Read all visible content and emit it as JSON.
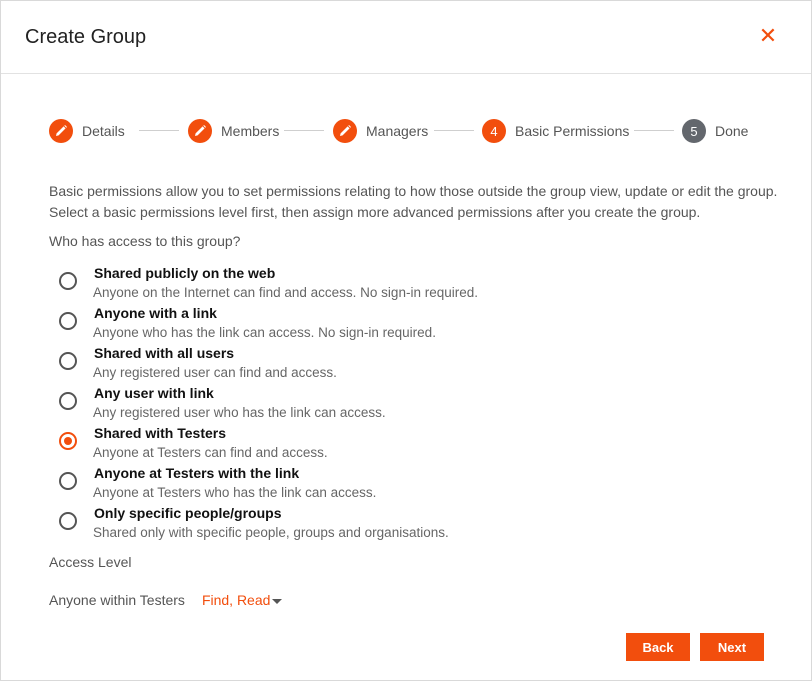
{
  "dialog": {
    "title": "Create Group",
    "close_symbol": "✕"
  },
  "stepper": {
    "steps": [
      {
        "label": "Details",
        "marker": "edit",
        "state": "complete"
      },
      {
        "label": "Members",
        "marker": "edit",
        "state": "complete"
      },
      {
        "label": "Managers",
        "marker": "edit",
        "state": "complete"
      },
      {
        "label": "Basic Permissions",
        "marker": "4",
        "state": "active"
      },
      {
        "label": "Done",
        "marker": "5",
        "state": "upcoming"
      }
    ]
  },
  "description": {
    "line1": "Basic permissions allow you to set permissions relating to how those outside the group view, update or edit the group.",
    "line2": "Select a basic permissions level first, then assign more advanced permissions after you create the group."
  },
  "question": "Who has access to this group?",
  "options": [
    {
      "title": "Shared publicly on the web",
      "subtitle": "Anyone on the Internet can find and access. No sign-in required.",
      "checked": false
    },
    {
      "title": "Anyone with a link",
      "subtitle": "Anyone who has the link can access. No sign-in required.",
      "checked": false
    },
    {
      "title": "Shared with all users",
      "subtitle": "Any registered user can find and access.",
      "checked": false
    },
    {
      "title": "Any user with link",
      "subtitle": "Any registered user who has the link can access.",
      "checked": false
    },
    {
      "title": "Shared with Testers",
      "subtitle": "Anyone at Testers can find and access.",
      "checked": true
    },
    {
      "title": "Anyone at Testers with the link",
      "subtitle": "Anyone at Testers who has the link can access.",
      "checked": false
    },
    {
      "title": "Only specific people/groups",
      "subtitle": "Shared only with specific people, groups and organisations.",
      "checked": false
    }
  ],
  "access": {
    "label": "Access Level",
    "row_label": "Anyone within Testers",
    "value": "Find, Read"
  },
  "buttons": {
    "back": "Back",
    "next": "Next"
  },
  "colors": {
    "accent": "#f24e0d",
    "step_upcoming": "#63676d"
  }
}
